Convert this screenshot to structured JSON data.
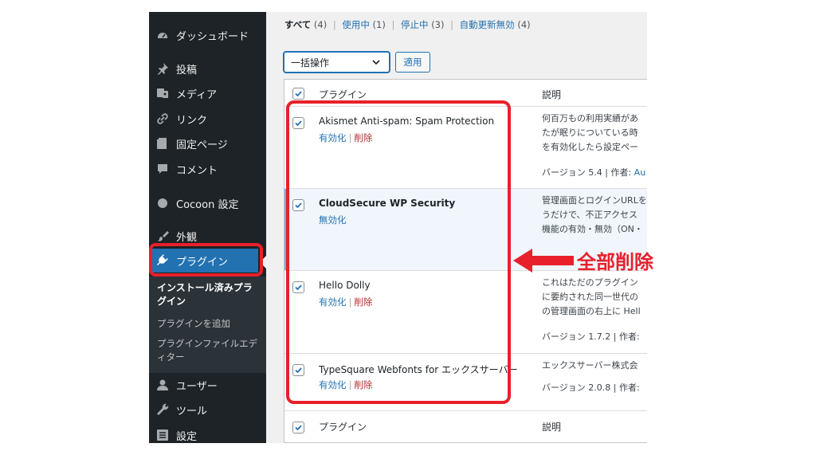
{
  "sidebar": {
    "items": [
      {
        "label": "ダッシュボード",
        "icon": "dashboard-icon"
      },
      {
        "label": "投稿",
        "icon": "pin-icon"
      },
      {
        "label": "メディア",
        "icon": "media-icon"
      },
      {
        "label": "リンク",
        "icon": "link-icon"
      },
      {
        "label": "固定ページ",
        "icon": "page-icon"
      },
      {
        "label": "コメント",
        "icon": "comment-icon"
      },
      {
        "label": "Cocoon 設定",
        "icon": "cocoon-icon"
      },
      {
        "label": "外観",
        "icon": "appearance-icon"
      },
      {
        "label": "プラグイン",
        "icon": "plugin-icon"
      },
      {
        "label": "ユーザー",
        "icon": "user-icon"
      },
      {
        "label": "ツール",
        "icon": "tools-icon"
      },
      {
        "label": "設定",
        "icon": "settings-icon"
      }
    ],
    "submenu": [
      {
        "label": "インストール済みプラグイン"
      },
      {
        "label": "プラグインを追加"
      },
      {
        "label": "プラグインファイルエディター"
      }
    ]
  },
  "filters": {
    "all": {
      "label": "すべて",
      "count": "(4)"
    },
    "active": {
      "label": "使用中",
      "count": "(1)"
    },
    "inactive": {
      "label": "停止中",
      "count": "(3)"
    },
    "autoupdate_off": {
      "label": "自動更新無効",
      "count": "(4)"
    }
  },
  "bulk": {
    "selected": "一括操作",
    "apply_label": "適用"
  },
  "table": {
    "headers": {
      "plugin": "プラグイン",
      "description": "説明"
    },
    "plugins": [
      {
        "name": "Akismet Anti-spam: Spam Protection",
        "actions": [
          "有効化",
          "削除"
        ],
        "description": [
          "何百万もの利用実績があ",
          "たが眠りについている時",
          "を有効化したら設定ペー"
        ],
        "version": "バージョン 5.4 | 作者: ",
        "author": "Au"
      },
      {
        "name": "CloudSecure WP Security",
        "actions": [
          "無効化"
        ],
        "description": [
          "管理画面とログインURLを",
          "うだけで、不正アクセス",
          "機能の有効・無効（ON・"
        ],
        "version": "",
        "author": ""
      },
      {
        "name": "Hello Dolly",
        "actions": [
          "有効化",
          "削除"
        ],
        "description": [
          "これはただのプラグイン",
          "に要約された同一世代の",
          "の管理画面の右上に Hell"
        ],
        "version": "バージョン 1.7.2 | 作者: ",
        "author": ""
      },
      {
        "name": "TypeSquare Webfonts for エックスサーバー",
        "actions": [
          "有効化",
          "削除"
        ],
        "description": [
          "エックスサーバー株式会"
        ],
        "version": "バージョン 2.0.8 | 作者: ",
        "author": ""
      }
    ]
  },
  "annotation": {
    "text": "全部削除",
    "color": "#e8202b"
  },
  "colors": {
    "sidebar_bg": "#1d2327",
    "accent": "#2271b1",
    "highlight": "#e8202b",
    "delete": "#b32d2e"
  }
}
